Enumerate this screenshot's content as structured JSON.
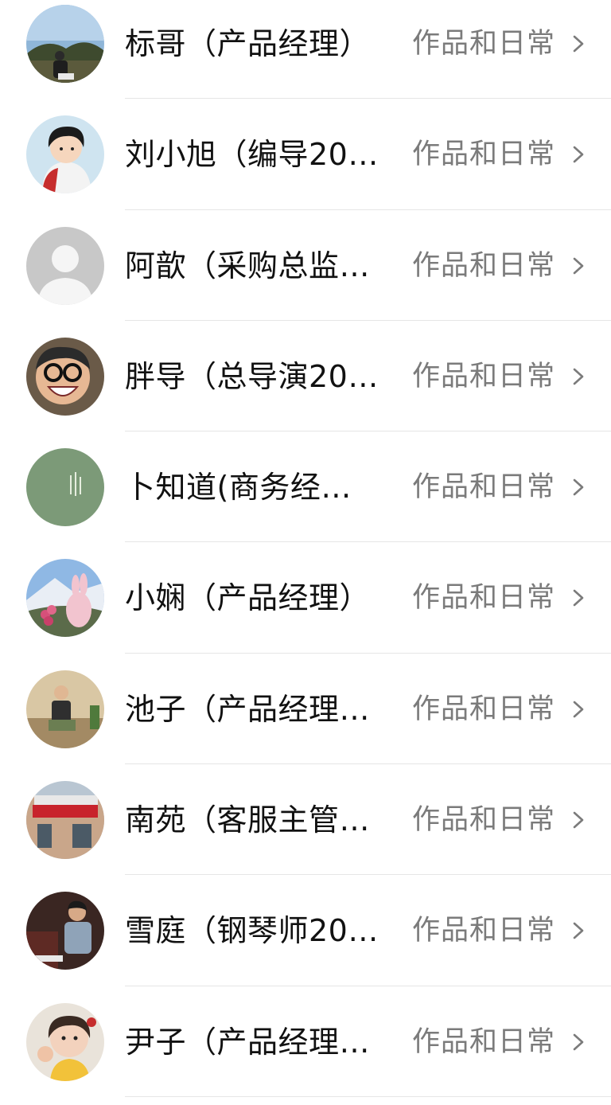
{
  "contacts": [
    {
      "name": "标哥（产品经理）",
      "action": "作品和日常",
      "avatar": "landscape-photo-avatar"
    },
    {
      "name": "刘小旭（编导20…",
      "action": "作品和日常",
      "avatar": "anime-boy-avatar"
    },
    {
      "name": "阿歆（采购总监…",
      "action": "作品和日常",
      "avatar": "default-person-avatar"
    },
    {
      "name": "胖导（总导演20…",
      "action": "作品和日常",
      "avatar": "laughing-man-avatar"
    },
    {
      "name": "卜知道(商务经…",
      "action": "作品和日常",
      "avatar": "green-calligraphy-avatar"
    },
    {
      "name": "小娴（产品经理）",
      "action": "作品和日常",
      "avatar": "bunny-mountain-avatar"
    },
    {
      "name": "池子（产品经理…",
      "action": "作品和日常",
      "avatar": "seated-man-avatar"
    },
    {
      "name": "南苑（客服主管…",
      "action": "作品和日常",
      "avatar": "lottery-shop-avatar"
    },
    {
      "name": "雪庭（钢琴师20…",
      "action": "作品和日常",
      "avatar": "pianist-avatar"
    },
    {
      "name": "尹子（产品经理…",
      "action": "作品和日常",
      "avatar": "little-girl-avatar"
    }
  ],
  "colors": {
    "name_text": "#111111",
    "action_text": "#7b7b7b",
    "divider": "#e6e6e6",
    "background": "#ffffff"
  }
}
